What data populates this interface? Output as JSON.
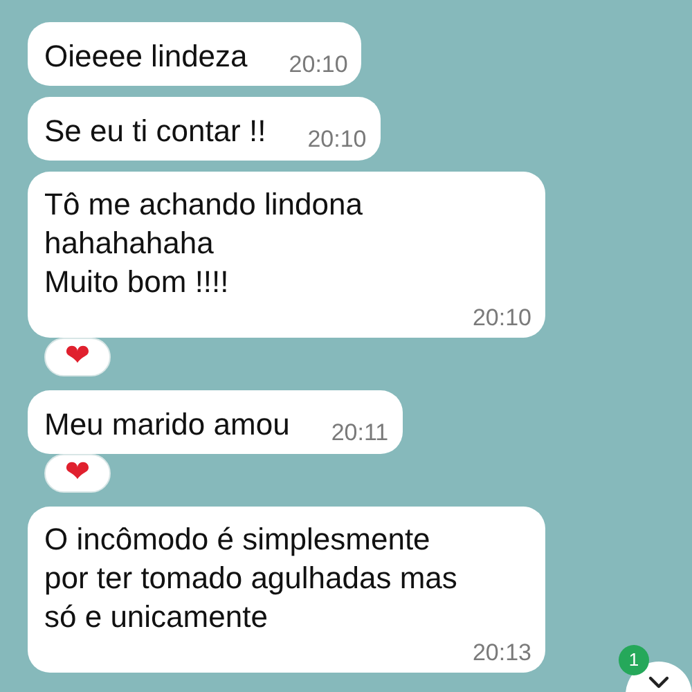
{
  "messages": [
    {
      "kind": "short",
      "text": "Oieeee lindeza",
      "time": "20:10"
    },
    {
      "kind": "short",
      "text": "Se eu ti contar !!",
      "time": "20:10"
    },
    {
      "kind": "long",
      "text": "Tô me achando lindona\nhahahahaha\nMuito bom !!!!",
      "time": "20:10",
      "reaction": "❤"
    },
    {
      "kind": "short",
      "text": "Meu marido amou",
      "time": "20:11",
      "reaction": "❤"
    },
    {
      "kind": "long",
      "text": "O incômodo é simplesmente por ter tomado agulhadas mas só e unicamente",
      "time": "20:13"
    }
  ],
  "scroll_down": {
    "unread_badge": "1"
  }
}
